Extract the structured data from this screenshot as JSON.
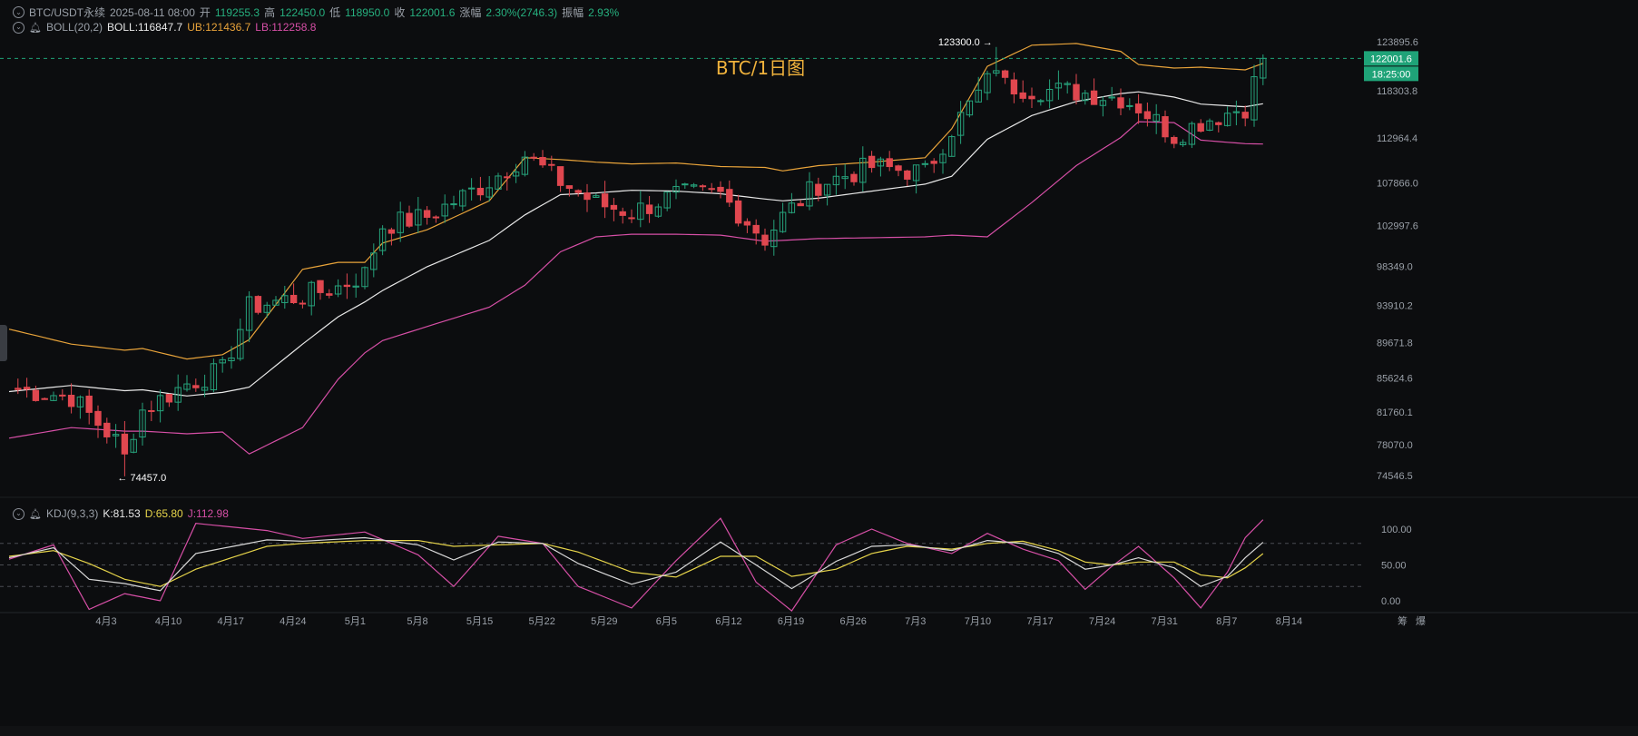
{
  "header": {
    "symbol": "BTC/USDT永续",
    "datetime": "2025-08-11 08:00",
    "open_label": "开",
    "open": "119255.3",
    "high_label": "高",
    "high": "122450.0",
    "low_label": "低",
    "low": "118950.0",
    "close_label": "收",
    "close": "122001.6",
    "change_label": "涨幅",
    "change": "2.30%(2746.3)",
    "amplitude_label": "振幅",
    "amplitude": "2.93%"
  },
  "boll": {
    "label": "BOLL(20,2)",
    "mid": "BOLL:116847.7",
    "ub": "UB:121436.7",
    "lb": "LB:112258.8"
  },
  "kdj": {
    "label": "KDJ(9,3,3)",
    "k": "K:81.53",
    "d": "D:65.80",
    "j": "J:112.98"
  },
  "bottom_labels": {
    "left": "筹",
    "right": "爆"
  },
  "colors": {
    "background": "#0c0d0f",
    "up": "#26a27b",
    "down": "#e0474f",
    "boll_mid": "#e8e8e8",
    "boll_ub": "#e8a33a",
    "boll_lb": "#d64fa6",
    "k_line": "#d9d9d9",
    "d_line": "#e6d44a",
    "j_line": "#d64fa6",
    "price_tag": "#1fa378"
  },
  "chart_data": {
    "type": "candlestick",
    "title": "BTC/1日图",
    "y_ticks": [
      "123895.6",
      "118303.8",
      "112964.4",
      "107866.0",
      "102997.6",
      "98349.0",
      "93910.2",
      "89671.8",
      "85624.6",
      "81760.1",
      "78070.0",
      "74546.5"
    ],
    "ylim": [
      74546.5,
      123895.6
    ],
    "x_ticks": [
      "4月3",
      "4月10",
      "4月17",
      "4月24",
      "5月1",
      "5月8",
      "5月15",
      "5月22",
      "5月29",
      "6月5",
      "6月12",
      "6月19",
      "6月26",
      "7月3",
      "7月10",
      "7月17",
      "7月24",
      "7月31",
      "8月7",
      "8月14"
    ],
    "last_price": "122001.6",
    "countdown": "18:25:00",
    "annotations": [
      {
        "text": "123300.0 →",
        "value": 123300.0,
        "date_index": 111
      },
      {
        "text": "← 74457.0",
        "value": 74457.0,
        "date_index": 13
      }
    ],
    "candle_anchors": [
      {
        "i": 0,
        "c": 84500,
        "bb_mid": 84100,
        "bb_ub": 91200,
        "bb_lb": 78800
      },
      {
        "i": 7,
        "c": 83500,
        "bb_mid": 84800,
        "bb_ub": 89500,
        "bb_lb": 80000
      },
      {
        "i": 13,
        "c": 77500,
        "bb_mid": 84200,
        "bb_ub": 88800,
        "bb_lb": 79600
      },
      {
        "i": 15,
        "c": 82000,
        "bb_mid": 84300,
        "bb_ub": 89000,
        "bb_lb": 79600
      },
      {
        "i": 20,
        "c": 85000,
        "bb_mid": 83600,
        "bb_ub": 87800,
        "bb_lb": 79300
      },
      {
        "i": 24,
        "c": 86500,
        "bb_mid": 84000,
        "bb_ub": 88300,
        "bb_lb": 79500
      },
      {
        "i": 27,
        "c": 93700,
        "bb_mid": 84600,
        "bb_ub": 90000,
        "bb_lb": 77000
      },
      {
        "i": 33,
        "c": 95000,
        "bb_mid": 89500,
        "bb_ub": 98000,
        "bb_lb": 80000
      },
      {
        "i": 37,
        "c": 96000,
        "bb_mid": 92600,
        "bb_ub": 98800,
        "bb_lb": 85500
      },
      {
        "i": 40,
        "c": 97500,
        "bb_mid": 94300,
        "bb_ub": 98800,
        "bb_lb": 88500
      },
      {
        "i": 42,
        "c": 103000,
        "bb_mid": 95600,
        "bb_ub": 101000,
        "bb_lb": 89900
      },
      {
        "i": 47,
        "c": 104000,
        "bb_mid": 98300,
        "bb_ub": 102500,
        "bb_lb": 91500
      },
      {
        "i": 54,
        "c": 108000,
        "bb_mid": 101300,
        "bb_ub": 105800,
        "bb_lb": 93700
      },
      {
        "i": 58,
        "c": 111000,
        "bb_mid": 104200,
        "bb_ub": 110700,
        "bb_lb": 96200
      },
      {
        "i": 62,
        "c": 108000,
        "bb_mid": 106500,
        "bb_ub": 110500,
        "bb_lb": 100000
      },
      {
        "i": 66,
        "c": 105500,
        "bb_mid": 106700,
        "bb_ub": 110200,
        "bb_lb": 101700
      },
      {
        "i": 70,
        "c": 104500,
        "bb_mid": 107000,
        "bb_ub": 110000,
        "bb_lb": 102000
      },
      {
        "i": 75,
        "c": 106500,
        "bb_mid": 106900,
        "bb_ub": 110100,
        "bb_lb": 102000
      },
      {
        "i": 80,
        "c": 106500,
        "bb_mid": 106600,
        "bb_ub": 109700,
        "bb_lb": 101900
      },
      {
        "i": 85,
        "c": 101500,
        "bb_mid": 106000,
        "bb_ub": 109600,
        "bb_lb": 101200
      },
      {
        "i": 87,
        "c": 104000,
        "bb_mid": 105800,
        "bb_ub": 109200,
        "bb_lb": 101300
      },
      {
        "i": 91,
        "c": 107700,
        "bb_mid": 106100,
        "bb_ub": 109800,
        "bb_lb": 101500
      },
      {
        "i": 97,
        "c": 109700,
        "bb_mid": 106900,
        "bb_ub": 110200,
        "bb_lb": 101600
      },
      {
        "i": 103,
        "c": 109000,
        "bb_mid": 107700,
        "bb_ub": 110700,
        "bb_lb": 101700
      },
      {
        "i": 106,
        "c": 114000,
        "bb_mid": 108600,
        "bb_ub": 114000,
        "bb_lb": 101900
      },
      {
        "i": 110,
        "c": 119300,
        "bb_mid": 112800,
        "bb_ub": 121100,
        "bb_lb": 101700
      },
      {
        "i": 115,
        "c": 118500,
        "bb_mid": 115500,
        "bb_ub": 123500,
        "bb_lb": 105600
      },
      {
        "i": 120,
        "c": 118200,
        "bb_mid": 117100,
        "bb_ub": 123700,
        "bb_lb": 109800
      },
      {
        "i": 125,
        "c": 117500,
        "bb_mid": 118000,
        "bb_ub": 122800,
        "bb_lb": 113000
      },
      {
        "i": 127,
        "c": 116500,
        "bb_mid": 118200,
        "bb_ub": 121300,
        "bb_lb": 114800
      },
      {
        "i": 131,
        "c": 113200,
        "bb_mid": 117600,
        "bb_ub": 120900,
        "bb_lb": 114700
      },
      {
        "i": 134,
        "c": 114800,
        "bb_mid": 116800,
        "bb_ub": 121000,
        "bb_lb": 112700
      },
      {
        "i": 139,
        "c": 116500,
        "bb_mid": 116500,
        "bb_ub": 120700,
        "bb_lb": 112300
      },
      {
        "i": 141,
        "c": 122001.6,
        "bb_mid": 116847.7,
        "bb_ub": 121436.7,
        "bb_lb": 112258.8
      }
    ],
    "kdj_axis": {
      "ticks": [
        "100.00",
        "50.00",
        "0.00"
      ],
      "ylim": [
        0,
        100
      ],
      "dashed_levels": [
        80,
        50,
        20
      ]
    },
    "kdj_anchors": [
      {
        "i": 0,
        "k": 60,
        "d": 62,
        "j": 58
      },
      {
        "i": 5,
        "k": 74,
        "d": 70,
        "j": 78
      },
      {
        "i": 9,
        "k": 30,
        "d": 52,
        "j": -12
      },
      {
        "i": 13,
        "k": 24,
        "d": 30,
        "j": 10
      },
      {
        "i": 17,
        "k": 14,
        "d": 20,
        "j": 0
      },
      {
        "i": 21,
        "k": 66,
        "d": 44,
        "j": 108
      },
      {
        "i": 29,
        "k": 85,
        "d": 76,
        "j": 98
      },
      {
        "i": 33,
        "k": 83,
        "d": 80,
        "j": 87
      },
      {
        "i": 40,
        "k": 88,
        "d": 84,
        "j": 96
      },
      {
        "i": 46,
        "k": 78,
        "d": 84,
        "j": 64
      },
      {
        "i": 50,
        "k": 57,
        "d": 76,
        "j": 20
      },
      {
        "i": 55,
        "k": 82,
        "d": 78,
        "j": 90
      },
      {
        "i": 60,
        "k": 80,
        "d": 80,
        "j": 80
      },
      {
        "i": 64,
        "k": 52,
        "d": 68,
        "j": 20
      },
      {
        "i": 70,
        "k": 23,
        "d": 40,
        "j": -10
      },
      {
        "i": 75,
        "k": 40,
        "d": 33,
        "j": 56
      },
      {
        "i": 80,
        "k": 82,
        "d": 62,
        "j": 115
      },
      {
        "i": 84,
        "k": 50,
        "d": 62,
        "j": 26
      },
      {
        "i": 88,
        "k": 17,
        "d": 34,
        "j": -14
      },
      {
        "i": 93,
        "k": 55,
        "d": 44,
        "j": 78
      },
      {
        "i": 97,
        "k": 76,
        "d": 66,
        "j": 100
      },
      {
        "i": 101,
        "k": 78,
        "d": 76,
        "j": 80
      },
      {
        "i": 106,
        "k": 70,
        "d": 72,
        "j": 66
      },
      {
        "i": 110,
        "k": 84,
        "d": 80,
        "j": 94
      },
      {
        "i": 114,
        "k": 80,
        "d": 83,
        "j": 72
      },
      {
        "i": 118,
        "k": 66,
        "d": 70,
        "j": 56
      },
      {
        "i": 121,
        "k": 44,
        "d": 54,
        "j": 16
      },
      {
        "i": 124,
        "k": 50,
        "d": 50,
        "j": 48
      },
      {
        "i": 127,
        "k": 60,
        "d": 54,
        "j": 76
      },
      {
        "i": 131,
        "k": 46,
        "d": 54,
        "j": 32
      },
      {
        "i": 134,
        "k": 20,
        "d": 36,
        "j": -10
      },
      {
        "i": 137,
        "k": 34,
        "d": 32,
        "j": 40
      },
      {
        "i": 139,
        "k": 60,
        "d": 46,
        "j": 88
      },
      {
        "i": 141,
        "k": 81.53,
        "d": 65.8,
        "j": 112.98
      }
    ]
  }
}
